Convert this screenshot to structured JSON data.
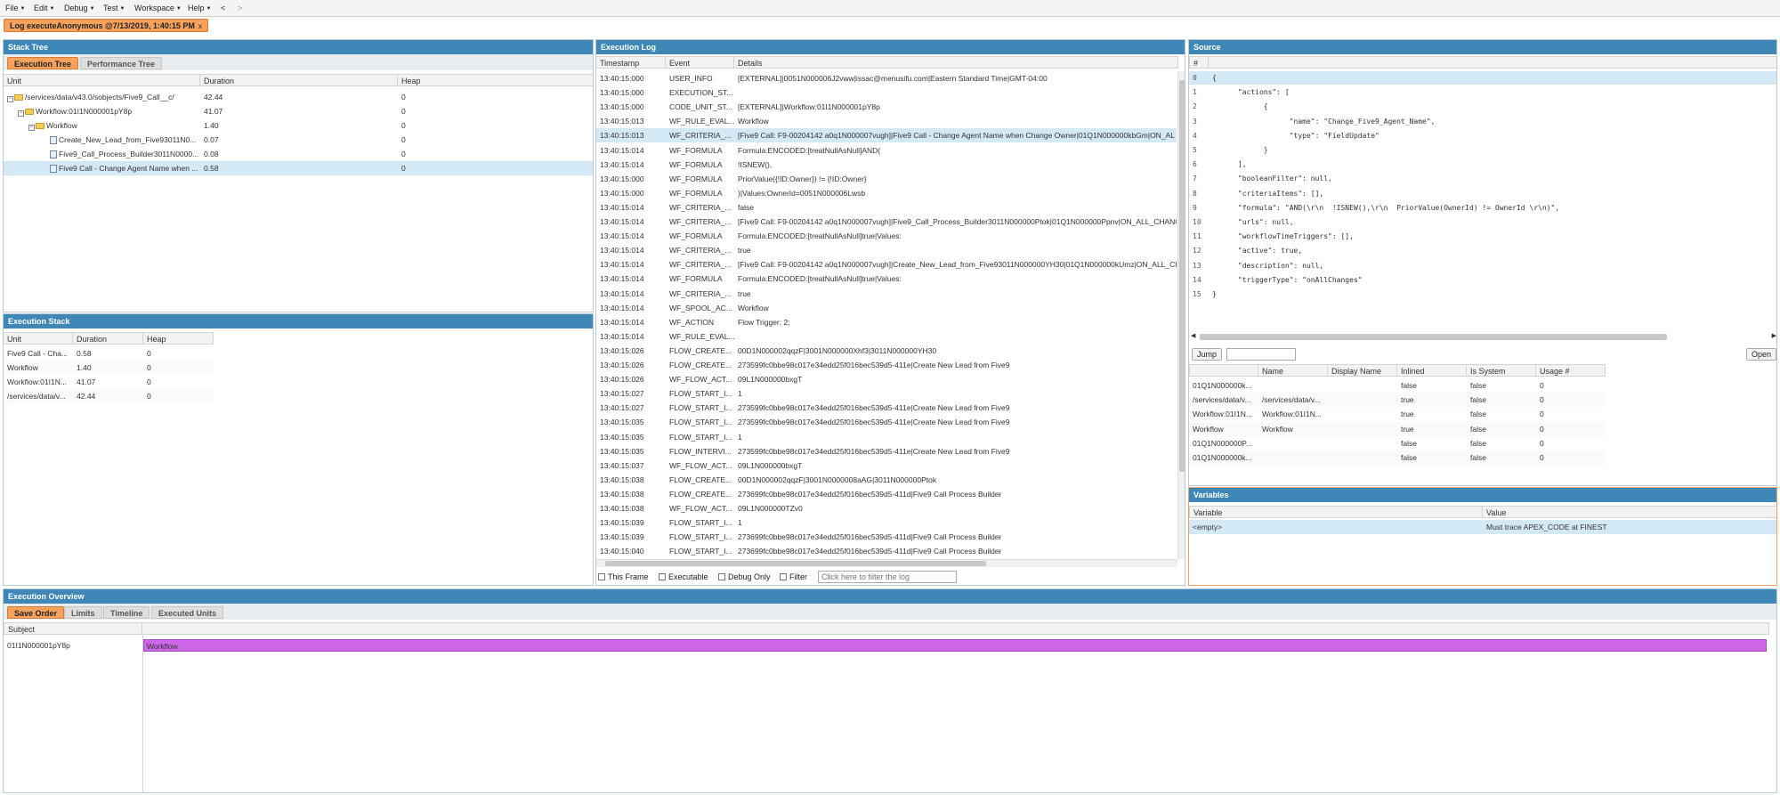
{
  "menu": [
    "File",
    "Edit",
    "Debug",
    "Test",
    "Workspace",
    "Help"
  ],
  "nav": {
    "back": "<",
    "forward": ">"
  },
  "doc_tab": {
    "label": "Log executeAnonymous @7/13/2019, 1:40:15 PM",
    "close": "x"
  },
  "stack_tree": {
    "title": "Stack Tree",
    "tabs": [
      "Execution Tree",
      "Performance Tree"
    ],
    "columns": [
      "Unit",
      "Duration",
      "Heap"
    ],
    "rows": [
      {
        "unit": "/services/data/v43.0/sobjects/Five9_Call__c/",
        "duration": "42.44",
        "heap": "0"
      },
      {
        "unit": "Workflow:01I1N000001pY8p",
        "duration": "41.07",
        "heap": "0"
      },
      {
        "unit": "Workflow",
        "duration": "1.40",
        "heap": "0"
      },
      {
        "unit": "Create_New_Lead_from_Five93011N0...",
        "duration": "0.07",
        "heap": "0"
      },
      {
        "unit": "Five9_Call_Process_Builder3011N0000...",
        "duration": "0.08",
        "heap": "0"
      },
      {
        "unit": "Five9 Call - Change Agent Name when ...",
        "duration": "0.58",
        "heap": "0"
      }
    ]
  },
  "exec_stack": {
    "title": "Execution Stack",
    "columns": [
      "Unit",
      "Duration",
      "Heap"
    ],
    "rows": [
      {
        "unit": "Five9 Call - Cha...",
        "duration": "0.58",
        "heap": "0"
      },
      {
        "unit": "Workflow",
        "duration": "1.40",
        "heap": "0"
      },
      {
        "unit": "Workflow:01I1N...",
        "duration": "41.07",
        "heap": "0"
      },
      {
        "unit": "/services/data/v...",
        "duration": "42.44",
        "heap": "0"
      }
    ]
  },
  "exec_log": {
    "title": "Execution Log",
    "columns": [
      "Timestamp",
      "Event",
      "Details"
    ],
    "rows": [
      [
        "13:40:15:000",
        "USER_INFO",
        "[EXTERNAL]|0051N000006J2vww|issac@menusifu.com|Eastern Standard Time|GMT-04:00"
      ],
      [
        "13:40:15:000",
        "EXECUTION_ST...",
        ""
      ],
      [
        "13:40:15:000",
        "CODE_UNIT_ST...",
        "[EXTERNAL]|Workflow:01I1N000001pY8p"
      ],
      [
        "13:40:15:013",
        "WF_RULE_EVAL...",
        "Workflow"
      ],
      [
        "13:40:15:013",
        "WF_CRITERIA_...",
        "[Five9 Call: F9-00204142 a0q1N000007vugh]|Five9 Call - Change Agent Name when Change Owner|01Q1N000000kbGm|ON_AL"
      ],
      [
        "13:40:15:014",
        "WF_FORMULA",
        "Formula:ENCODED:[treatNullAsNull]AND("
      ],
      [
        "13:40:15:014",
        "WF_FORMULA",
        "!ISNEW(),"
      ],
      [
        "13:40:15:000",
        "WF_FORMULA",
        "PriorValue({!ID:Owner}) != {!ID:Owner}"
      ],
      [
        "13:40:15:000",
        "WF_FORMULA",
        ")|Values:OwnerId=0051N000006Lwsb"
      ],
      [
        "13:40:15:014",
        "WF_CRITERIA_...",
        "false"
      ],
      [
        "13:40:15:014",
        "WF_CRITERIA_...",
        "[Five9 Call: F9-00204142 a0q1N000007vugh]|Five9_Call_Process_Builder3011N000000Ptok|01Q1N000000Ppnv|ON_ALL_CHANG"
      ],
      [
        "13:40:15:014",
        "WF_FORMULA",
        "Formula:ENCODED:[treatNullAsNull]true|Values:"
      ],
      [
        "13:40:15:014",
        "WF_CRITERIA_...",
        "true"
      ],
      [
        "13:40:15:014",
        "WF_CRITERIA_...",
        "[Five9 Call: F9-00204142 a0q1N000007vugh]|Create_New_Lead_from_Five93011N000000YH30|01Q1N000000kUmz|ON_ALL_CH"
      ],
      [
        "13:40:15:014",
        "WF_FORMULA",
        "Formula:ENCODED:[treatNullAsNull]true|Values:"
      ],
      [
        "13:40:15:014",
        "WF_CRITERIA_...",
        "true"
      ],
      [
        "13:40:15:014",
        "WF_SPOOL_AC...",
        "Workflow"
      ],
      [
        "13:40:15:014",
        "WF_ACTION",
        "Flow Trigger: 2;"
      ],
      [
        "13:40:15:014",
        "WF_RULE_EVAL...",
        ""
      ],
      [
        "13:40:15:026",
        "FLOW_CREATE...",
        "00D1N000002qqzF|3001N000000Xhf3|3011N000000YH30"
      ],
      [
        "13:40:15:026",
        "FLOW_CREATE...",
        "273599fc0bbe98c017e34edd25f016bec539d5-411e|Create New Lead from Five9"
      ],
      [
        "13:40:15:026",
        "WF_FLOW_ACT...",
        "09L1N000000bxgT"
      ],
      [
        "13:40:15:027",
        "FLOW_START_I...",
        "1"
      ],
      [
        "13:40:15:027",
        "FLOW_START_I...",
        "273599fc0bbe98c017e34edd25f016bec539d5-411e|Create New Lead from Five9"
      ],
      [
        "13:40:15:035",
        "FLOW_START_I...",
        "273599fc0bbe98c017e34edd25f016bec539d5-411e|Create New Lead from Five9"
      ],
      [
        "13:40:15:035",
        "FLOW_START_I...",
        "1"
      ],
      [
        "13:40:15:035",
        "FLOW_INTERVI...",
        "273599fc0bbe98c017e34edd25f016bec539d5-411e|Create New Lead from Five9"
      ],
      [
        "13:40:15:037",
        "WF_FLOW_ACT...",
        "09L1N000000bxgT"
      ],
      [
        "13:40:15:038",
        "FLOW_CREATE...",
        "00D1N000002qqzF|3001N0000008aAG|3011N000000Ptok"
      ],
      [
        "13:40:15:038",
        "FLOW_CREATE...",
        "273699fc0bbe98c017e34edd25f016bec539d5-411d|Five9 Call Process Builder"
      ],
      [
        "13:40:15:038",
        "WF_FLOW_ACT...",
        "09L1N000000TZv0"
      ],
      [
        "13:40:15:039",
        "FLOW_START_I...",
        "1"
      ],
      [
        "13:40:15:039",
        "FLOW_START_I...",
        "273699fc0bbe98c017e34edd25f016bec539d5-411d|Five9 Call Process Builder"
      ],
      [
        "13:40:15:040",
        "FLOW_START_I...",
        "273699fc0bbe98c017e34edd25f016bec539d5-411d|Five9 Call Process Builder"
      ]
    ],
    "filters": {
      "this_frame": "This Frame",
      "executable": "Executable",
      "debug_only": "Debug Only",
      "filter": "Filter",
      "placeholder": "Click here to filter the log"
    }
  },
  "source": {
    "title": "Source",
    "hash": "#",
    "lines": [
      "{",
      "      \"actions\": [",
      "            {",
      "                  \"name\": \"Change_Five9_Agent_Name\",",
      "                  \"type\": \"FieldUpdate\"",
      "            }",
      "      ],",
      "      \"booleanFilter\": null,",
      "      \"criteriaItems\": [],",
      "      \"formula\": \"AND(\\r\\n  !ISNEW(),\\r\\n  PriorValue(OwnerId) != OwnerId \\r\\n)\",",
      "      \"urls\": null,",
      "      \"workflowTimeTriggers\": [],",
      "      \"active\": true,",
      "      \"description\": null,",
      "      \"triggerType\": \"onAllChanges\"",
      "}"
    ],
    "jump": "Jump",
    "open": "Open"
  },
  "units": {
    "columns": [
      "",
      "Name",
      "Display Name",
      "Inlined",
      "Is System",
      "Usage #"
    ],
    "rows": [
      [
        "01Q1N000000k...",
        "",
        "",
        "false",
        "false",
        "0"
      ],
      [
        "/services/data/v...",
        "/services/data/v...",
        "",
        "true",
        "false",
        "0"
      ],
      [
        "Workflow:01I1N...",
        "Workflow:01I1N...",
        "",
        "true",
        "false",
        "0"
      ],
      [
        "Workflow",
        "Workflow",
        "",
        "true",
        "false",
        "0"
      ],
      [
        "01Q1N000000P...",
        "",
        "",
        "false",
        "false",
        "0"
      ],
      [
        "01Q1N000000k...",
        "",
        "",
        "false",
        "false",
        "0"
      ]
    ]
  },
  "variables": {
    "title": "Variables",
    "columns": [
      "Variable",
      "Value"
    ],
    "rows": [
      [
        "<empty>",
        "Must trace APEX_CODE at FINEST"
      ]
    ]
  },
  "overview": {
    "title": "Execution Overview",
    "tabs": [
      "Save Order",
      "Limits",
      "Timeline",
      "Executed Units"
    ],
    "column": "Subject",
    "subject": "01I1N000001pY8p",
    "bar_label": "Workflow",
    "bar_color": "#cc66e6"
  }
}
